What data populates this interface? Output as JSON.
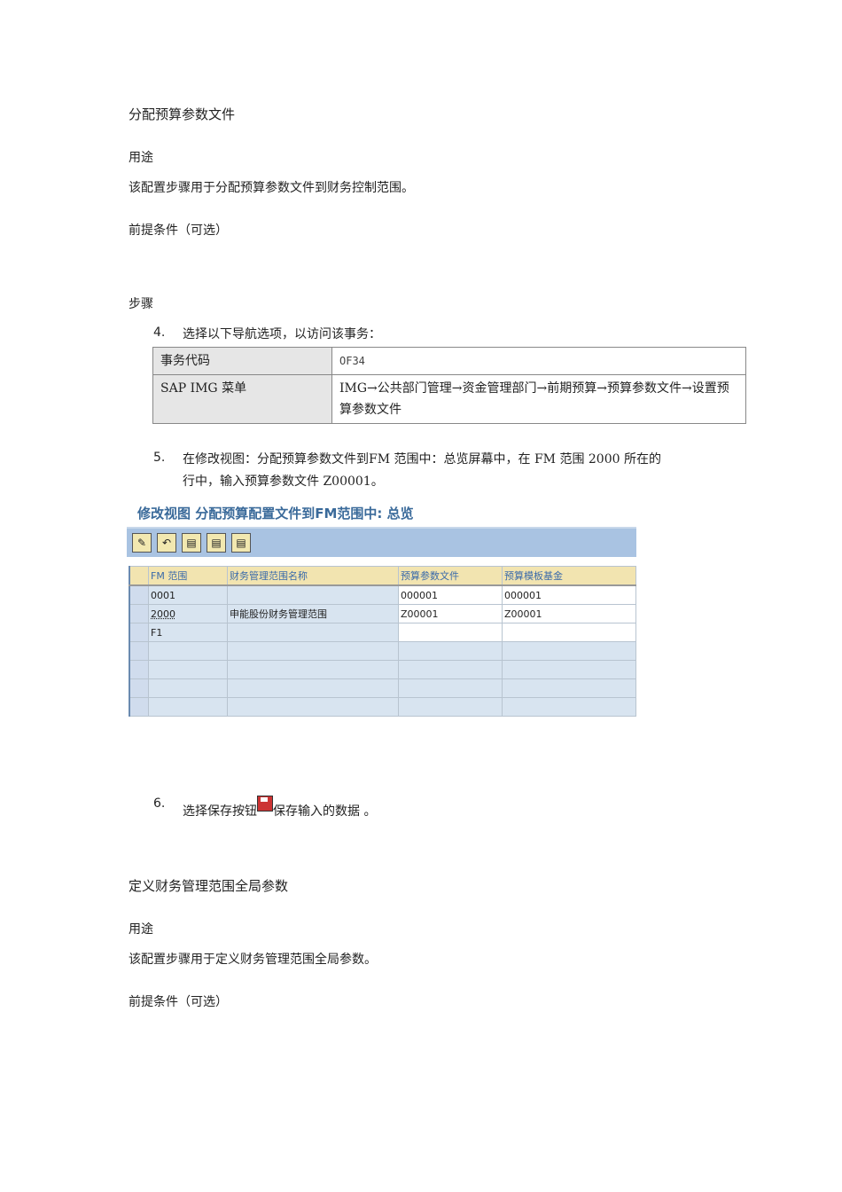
{
  "section1": {
    "title": "分配预算参数文件",
    "purpose_h": "用途",
    "purpose": "该配置步骤用于分配预算参数文件到财务控制范围。",
    "prereq": "前提条件（可选）",
    "steps_h": "步骤"
  },
  "step4": {
    "num": "4.",
    "text": "选择以下导航选项，以访问该事务："
  },
  "nav_table": [
    {
      "k": "事务代码",
      "v": "OF34"
    },
    {
      "k": "SAP IMG 菜单",
      "v": "IMG→公共部门管理→资金管理部门→前期预算→预算参数文件→设置预算参数文件"
    }
  ],
  "step5": {
    "num": "5.",
    "line1": "在修改视图：分配预算参数文件到FM 范围中：总览屏幕中，在 FM 范围 2000 所在的",
    "line2": "行中，输入预算参数文件 Z00001。"
  },
  "sap": {
    "title": "修改视图 分配预算配置文件到FM范围中: 总览",
    "toolbar": [
      "✎",
      "↶",
      "▤",
      "▤",
      "▤"
    ],
    "headers": [
      "FM 范围",
      "财务管理范围名称",
      "预算参数文件",
      "预算模板基金"
    ],
    "rows": [
      [
        "0001",
        "",
        "000001",
        "000001"
      ],
      [
        "2000",
        "申能股份财务管理范围",
        "Z00001",
        "Z00001"
      ],
      [
        "F1",
        "",
        "",
        ""
      ]
    ]
  },
  "step6": {
    "num": "6.",
    "a": "选择保存按钮",
    "b": "保存输入的数据 。"
  },
  "section2": {
    "title": "定义财务管理范围全局参数",
    "purpose_h": "用途",
    "purpose": "该配置步骤用于定义财务管理范围全局参数。",
    "prereq": "前提条件（可选）"
  }
}
